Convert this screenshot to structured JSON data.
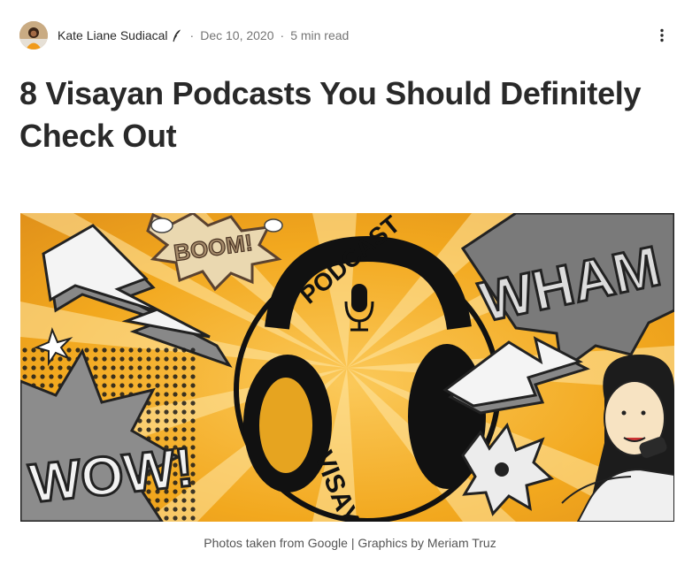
{
  "author": {
    "name": "Kate Liane Sudiacal",
    "avatar_icon": "avatar-photo",
    "badge_icon": "quill-icon"
  },
  "meta": {
    "date": "Dec 10, 2020",
    "separator": "·",
    "read_time": "5 min read"
  },
  "actions": {
    "more_icon": "more-vertical-icon"
  },
  "article": {
    "title": "8 Visayan Podcasts You Should Definitely Check Out",
    "hero_image": {
      "icon": "hero-illustration",
      "words": {
        "boom": "BOOM!",
        "podcast": "PODCAST",
        "wham": "WHAM",
        "wow": "WOW!",
        "visaya": "VISAYA"
      }
    },
    "caption": "Photos taken from Google | Graphics by Meriam Truz"
  },
  "colors": {
    "accent_orange": "#f2a81e",
    "text": "#292929",
    "muted": "#757575"
  }
}
